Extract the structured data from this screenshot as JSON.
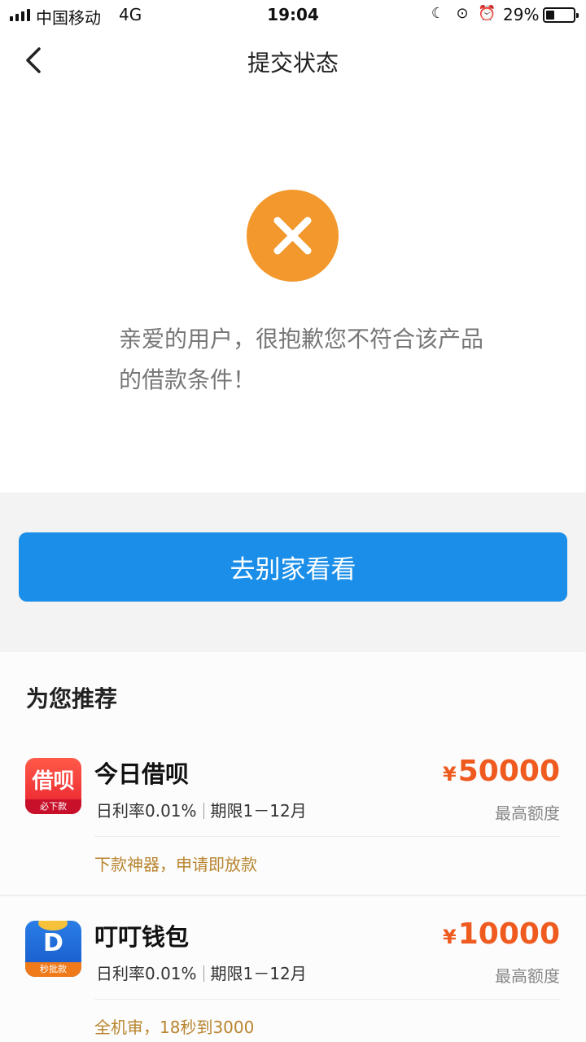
{
  "status_bar": {
    "carrier": "中国移动",
    "network": "4G",
    "time": "19:04",
    "battery_percent": "29%",
    "battery_level": 0.29,
    "icons": [
      "moon-icon",
      "rotation-lock-icon",
      "alarm-icon"
    ]
  },
  "nav": {
    "title": "提交状态",
    "back_icon": "chevron-left-icon"
  },
  "result": {
    "icon": "close-icon",
    "icon_color": "#f2982d",
    "message": "亲爱的用户，很抱歉您不符合该产品的借款条件！"
  },
  "action": {
    "button_label": "去别家看看",
    "button_color": "#1a8ee8"
  },
  "recommend": {
    "heading": "为您推荐",
    "amount_color": "#ef5a1f",
    "slogan_color": "#b8852f",
    "items": [
      {
        "name": "今日借呗",
        "icon_text": "借呗",
        "icon_badge": "必下款",
        "rate": "日利率0.01%",
        "term": "期限1－12月",
        "currency": "¥",
        "amount": "50000",
        "amount_label": "最高额度",
        "slogan": "下款神器，申请即放款"
      },
      {
        "name": "叮叮钱包",
        "icon_text": "D",
        "icon_badge": "秒批款",
        "rate": "日利率0.01%",
        "term": "期限1－12月",
        "currency": "¥",
        "amount": "10000",
        "amount_label": "最高额度",
        "slogan": "全机审，18秒到3000"
      }
    ]
  }
}
